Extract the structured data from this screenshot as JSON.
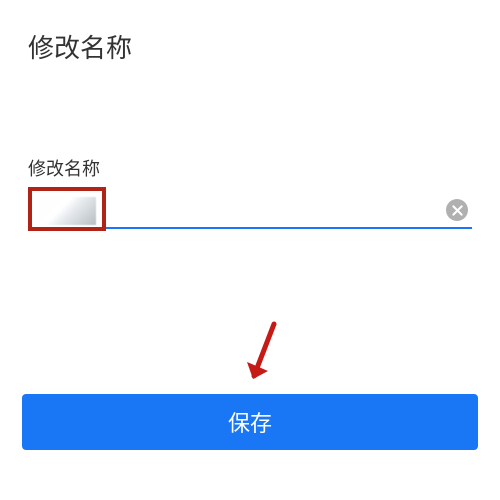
{
  "page": {
    "title": "修改名称"
  },
  "form": {
    "field_label": "修改名称",
    "name_value": "",
    "name_placeholder": ""
  },
  "actions": {
    "save_label": "保存"
  },
  "colors": {
    "primary": "#1976f5",
    "highlight_box": "#b02418",
    "arrow": "#c61a16"
  }
}
